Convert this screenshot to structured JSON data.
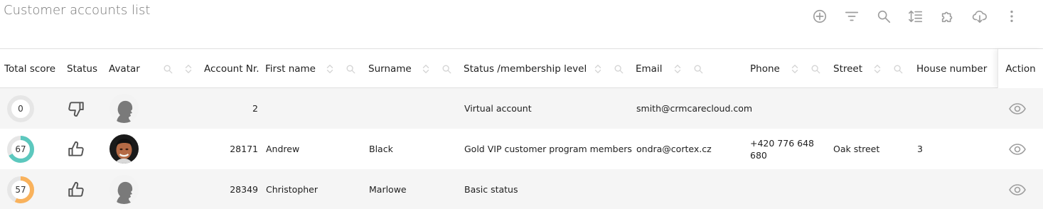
{
  "page": {
    "title": "Customer accounts list"
  },
  "toolbar": {
    "buttons": [
      {
        "name": "add-button",
        "icon": "plus-circle-icon"
      },
      {
        "name": "filter-button",
        "icon": "filter-icon"
      },
      {
        "name": "search-button",
        "icon": "search-icon"
      },
      {
        "name": "sort-button",
        "icon": "sort-lines-icon"
      },
      {
        "name": "extensions-button",
        "icon": "puzzle-icon"
      },
      {
        "name": "download-button",
        "icon": "cloud-download-icon"
      },
      {
        "name": "more-button",
        "icon": "vertical-dots-icon"
      }
    ]
  },
  "columns": {
    "total_score": "Total score",
    "status": "Status",
    "avatar": "Avatar",
    "account_nr": "Account Nr.",
    "first_name": "First name",
    "surname": "Surname",
    "membership": "Status /membership level",
    "email": "Email",
    "phone": "Phone",
    "street": "Street",
    "house_number": "House number",
    "action": "Action"
  },
  "rows": [
    {
      "score": "0",
      "score_fraction": 0,
      "score_color": "#e0e0e0",
      "status_icon": "thumbs-down-icon",
      "avatar": "silhouette",
      "account_nr": "2",
      "first_name": "",
      "surname": "",
      "membership": "Virtual account",
      "email": "smith@crmcarecloud.com",
      "phone": "",
      "street": "",
      "house_number": ""
    },
    {
      "score": "67",
      "score_fraction": 0.67,
      "score_color": "#5cc8be",
      "status_icon": "thumbs-up-icon",
      "avatar": "photo",
      "account_nr": "28171",
      "first_name": "Andrew",
      "surname": "Black",
      "membership": "Gold VIP customer program members",
      "email": "ondra@cortex.cz",
      "phone": "+420 776 648 680",
      "street": "Oak street",
      "house_number": "3"
    },
    {
      "score": "57",
      "score_fraction": 0.57,
      "score_color": "#f9b25c",
      "status_icon": "thumbs-up-icon",
      "avatar": "silhouette",
      "account_nr": "28349",
      "first_name": "Christopher",
      "surname": "Marlowe",
      "membership": "Basic status",
      "email": "",
      "phone": "",
      "street": "",
      "house_number": ""
    }
  ]
}
